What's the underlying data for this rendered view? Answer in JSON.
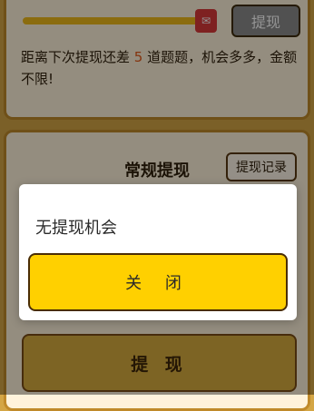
{
  "top_card": {
    "progress_fraction": 0.92,
    "withdraw_label": "提现",
    "note_prefix": "距离下次提现还差 ",
    "note_number": "5",
    "note_suffix": " 道题题，机会多多，金额不限!",
    "gift_icon": "red-envelope-icon"
  },
  "bottom_card": {
    "section_title": "常规提现",
    "record_button": "提现记录",
    "withdraw_button": "提 现"
  },
  "modal": {
    "title": "无提现机会",
    "close_button": "关 闭"
  },
  "colors": {
    "background": "#d4a645",
    "card": "#fff3db",
    "accent": "#ffd000",
    "disabled": "#8c8c8c",
    "number": "#e35b1a"
  }
}
